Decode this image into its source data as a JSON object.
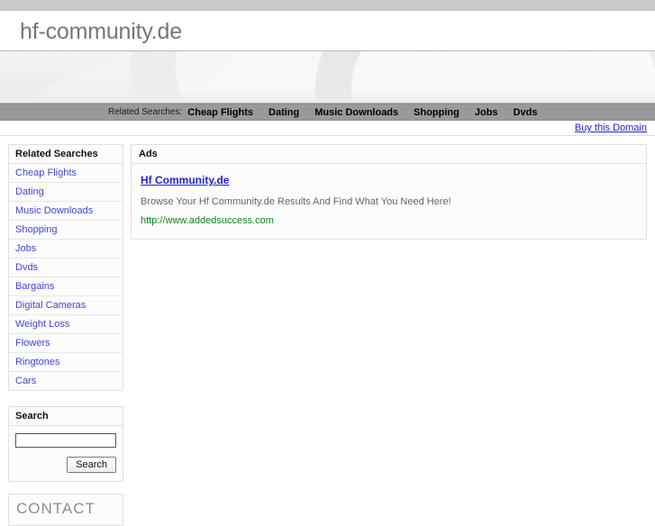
{
  "site": {
    "title": "hf-community.de"
  },
  "navbar": {
    "label": "Related Searches:",
    "items": [
      {
        "label": "Cheap Flights"
      },
      {
        "label": "Dating"
      },
      {
        "label": "Music Downloads"
      },
      {
        "label": "Shopping"
      },
      {
        "label": "Jobs"
      },
      {
        "label": "Dvds"
      }
    ]
  },
  "buy": {
    "label": "Buy this Domain"
  },
  "sidebar": {
    "related": {
      "heading": "Related Searches",
      "items": [
        {
          "label": "Cheap Flights"
        },
        {
          "label": "Dating"
        },
        {
          "label": "Music Downloads"
        },
        {
          "label": "Shopping"
        },
        {
          "label": "Jobs"
        },
        {
          "label": "Dvds"
        },
        {
          "label": "Bargains"
        },
        {
          "label": "Digital Cameras"
        },
        {
          "label": "Weight Loss"
        },
        {
          "label": "Flowers"
        },
        {
          "label": "Ringtones"
        },
        {
          "label": "Cars"
        }
      ]
    },
    "search": {
      "heading": "Search",
      "input_value": "",
      "input_placeholder": "",
      "button_label": "Search"
    },
    "contact": {
      "heading": "CONTACT"
    }
  },
  "main": {
    "ads_heading": "Ads",
    "ads": [
      {
        "title": "Hf Community.de",
        "description": "Browse Your Hf Community.de Results And Find What You Need Here!",
        "url": "http://www.addedsuccess.com"
      }
    ]
  },
  "colors": {
    "top_strip": "#c9c9c9",
    "navbar_bg": "#9a9a9a",
    "link_blue": "#4444dd",
    "ad_url_green": "#118811",
    "title_gray": "#767676"
  }
}
